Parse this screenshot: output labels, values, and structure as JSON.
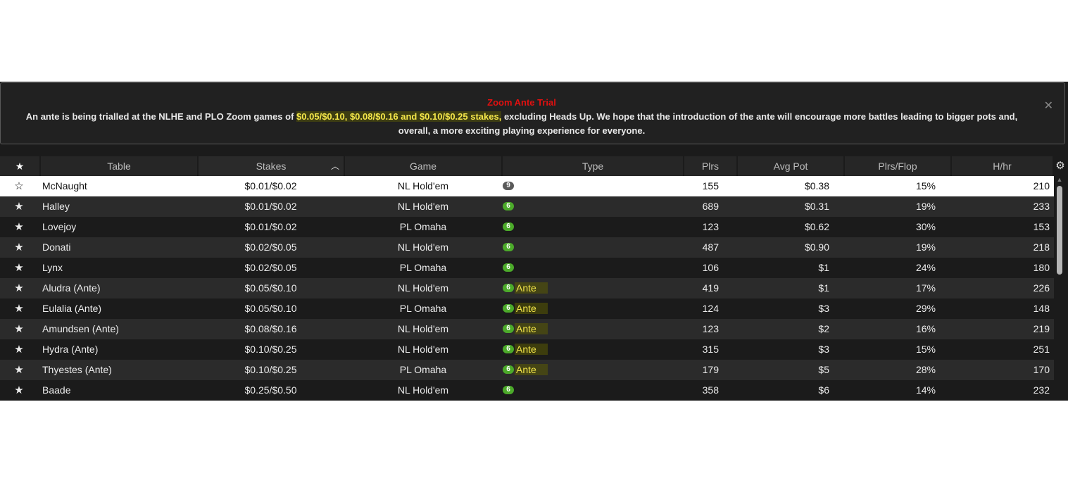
{
  "banner": {
    "title": "Zoom Ante Trial",
    "text_before": "An ante is being trialled at the NLHE and PLO Zoom games of ",
    "text_highlight": "$0.05/$0.10, $0.08/$0.16 and $0.10/$0.25 stakes,",
    "text_after": " excluding Heads Up. We hope that the introduction of the ante will encourage more battles leading to bigger pots and, overall, a more exciting playing experience for everyone.",
    "close_icon": "close-icon"
  },
  "columns": {
    "star": "★",
    "table": "Table",
    "stakes": "Stakes",
    "game": "Game",
    "type": "Type",
    "plrs": "Plrs",
    "avg_pot": "Avg Pot",
    "plrs_flop": "Plrs/Flop",
    "hhr": "H/hr",
    "sort_icon": "chevron-up-icon",
    "settings_icon": "gear-icon"
  },
  "rows": [
    {
      "star": "☆",
      "table": "McNaught",
      "stakes": "$0.01/$0.02",
      "game": "NL Hold'em",
      "badge": "9",
      "badge_color": "#5a5a5a",
      "ante": "",
      "plrs": "155",
      "avg_pot": "$0.38",
      "plrs_flop": "15%",
      "hhr": "210"
    },
    {
      "star": "★",
      "table": "Halley",
      "stakes": "$0.01/$0.02",
      "game": "NL Hold'em",
      "badge": "6",
      "badge_color": "#4caa2a",
      "ante": "",
      "plrs": "689",
      "avg_pot": "$0.31",
      "plrs_flop": "19%",
      "hhr": "233"
    },
    {
      "star": "★",
      "table": "Lovejoy",
      "stakes": "$0.01/$0.02",
      "game": "PL Omaha",
      "badge": "6",
      "badge_color": "#4caa2a",
      "ante": "",
      "plrs": "123",
      "avg_pot": "$0.62",
      "plrs_flop": "30%",
      "hhr": "153"
    },
    {
      "star": "★",
      "table": "Donati",
      "stakes": "$0.02/$0.05",
      "game": "NL Hold'em",
      "badge": "6",
      "badge_color": "#4caa2a",
      "ante": "",
      "plrs": "487",
      "avg_pot": "$0.90",
      "plrs_flop": "19%",
      "hhr": "218"
    },
    {
      "star": "★",
      "table": "Lynx",
      "stakes": "$0.02/$0.05",
      "game": "PL Omaha",
      "badge": "6",
      "badge_color": "#4caa2a",
      "ante": "",
      "plrs": "106",
      "avg_pot": "$1",
      "plrs_flop": "24%",
      "hhr": "180"
    },
    {
      "star": "★",
      "table": "Aludra (Ante)",
      "stakes": "$0.05/$0.10",
      "game": "NL Hold'em",
      "badge": "6",
      "badge_color": "#4caa2a",
      "ante": "Ante",
      "plrs": "419",
      "avg_pot": "$1",
      "plrs_flop": "17%",
      "hhr": "226"
    },
    {
      "star": "★",
      "table": "Eulalia (Ante)",
      "stakes": "$0.05/$0.10",
      "game": "PL Omaha",
      "badge": "6",
      "badge_color": "#4caa2a",
      "ante": "Ante",
      "plrs": "124",
      "avg_pot": "$3",
      "plrs_flop": "29%",
      "hhr": "148"
    },
    {
      "star": "★",
      "table": "Amundsen (Ante)",
      "stakes": "$0.08/$0.16",
      "game": "NL Hold'em",
      "badge": "6",
      "badge_color": "#4caa2a",
      "ante": "Ante",
      "plrs": "123",
      "avg_pot": "$2",
      "plrs_flop": "16%",
      "hhr": "219"
    },
    {
      "star": "★",
      "table": "Hydra (Ante)",
      "stakes": "$0.10/$0.25",
      "game": "NL Hold'em",
      "badge": "6",
      "badge_color": "#4caa2a",
      "ante": "Ante",
      "plrs": "315",
      "avg_pot": "$3",
      "plrs_flop": "15%",
      "hhr": "251"
    },
    {
      "star": "★",
      "table": "Thyestes (Ante)",
      "stakes": "$0.10/$0.25",
      "game": "PL Omaha",
      "badge": "6",
      "badge_color": "#4caa2a",
      "ante": "Ante",
      "plrs": "179",
      "avg_pot": "$5",
      "plrs_flop": "28%",
      "hhr": "170"
    },
    {
      "star": "★",
      "table": "Baade",
      "stakes": "$0.25/$0.50",
      "game": "NL Hold'em",
      "badge": "6",
      "badge_color": "#4caa2a",
      "ante": "",
      "plrs": "358",
      "avg_pot": "$6",
      "plrs_flop": "14%",
      "hhr": "232"
    }
  ],
  "colors": {
    "banner_title": "#e01010",
    "highlight": "#f4e64a",
    "selected_row": "#ffffff"
  }
}
